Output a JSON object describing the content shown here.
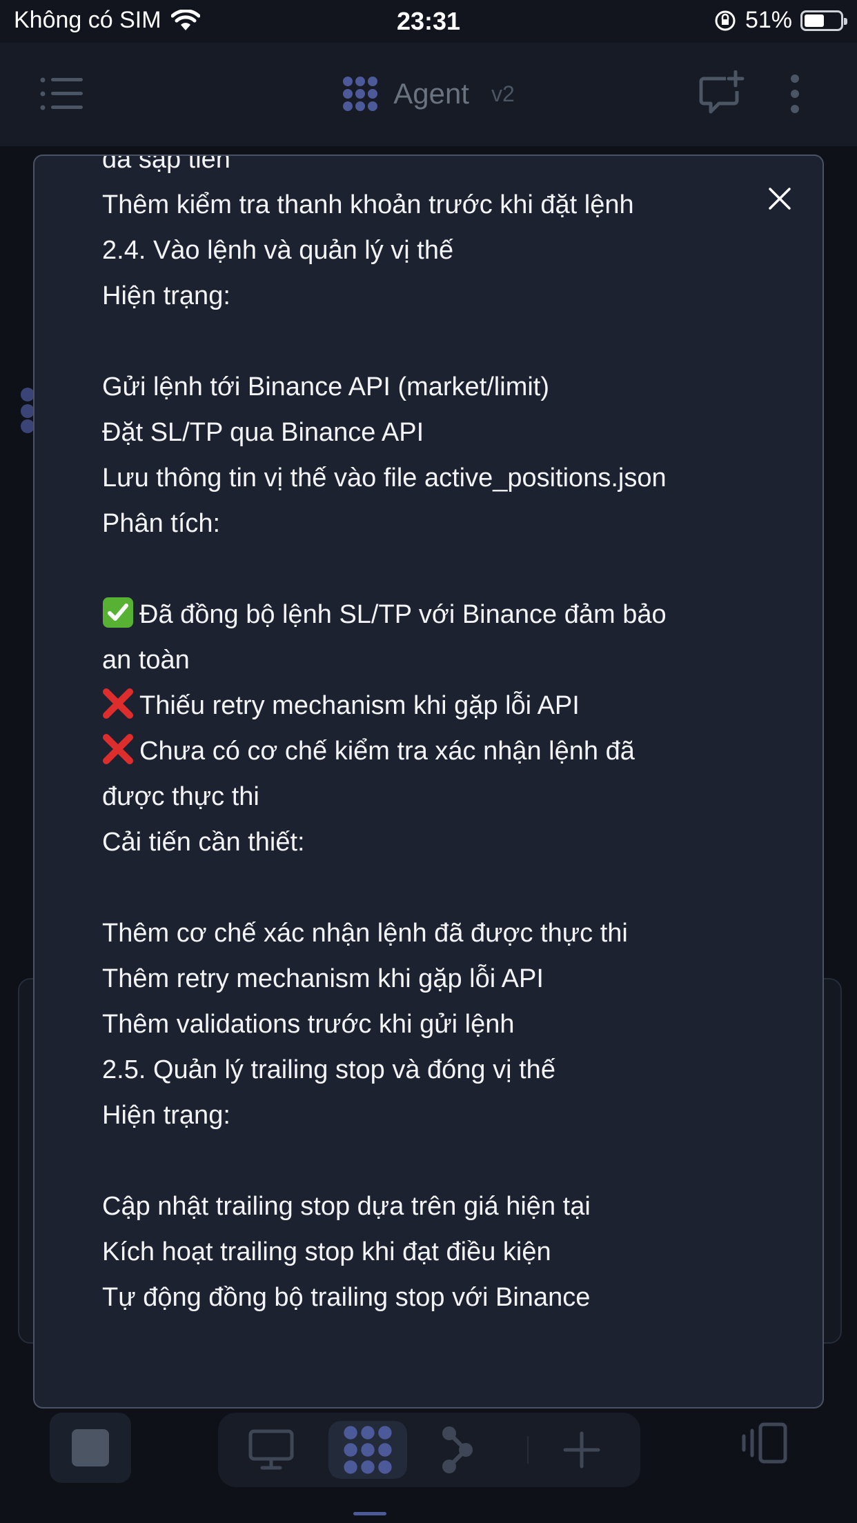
{
  "status_bar": {
    "carrier": "Không có SIM",
    "time": "23:31",
    "battery": "51%",
    "battery_level": 0.51,
    "icons": [
      "wifi-icon",
      "orientation-lock-icon",
      "battery-icon"
    ]
  },
  "header": {
    "title": "Agent",
    "version": "v2",
    "icons": [
      "menu-icon",
      "agent-logo-icon",
      "new-chat-icon",
      "more-vertical-icon"
    ]
  },
  "dialog": {
    "close_icon": "close-icon",
    "lines": [
      "đã sập tiền",
      "Thêm kiểm tra thanh khoản trước khi đặt lệnh",
      "2.4. Vào lệnh và quản lý vị thế",
      "Hiện trạng:",
      "",
      "Gửi lệnh tới Binance API (market/limit)",
      "Đặt SL/TP qua Binance API",
      "Lưu thông tin vị thế vào file active_positions.json",
      "Phân tích:",
      "",
      "Đã đồng bộ lệnh SL/TP với Binance đảm bảo",
      "an toàn",
      "Thiếu retry mechanism khi gặp lỗi API",
      "Chưa có cơ chế kiểm tra xác nhận lệnh đã",
      "được thực thi",
      "Cải tiến cần thiết:",
      "",
      "Thêm cơ chế xác nhận lệnh đã được thực thi",
      "Thêm retry mechanism khi gặp lỗi API",
      "Thêm validations trước khi gửi lệnh",
      "2.5. Quản lý trailing stop và đóng vị thế",
      "Hiện trạng:",
      "",
      "Cập nhật trailing stop dựa trên giá hiện tại",
      "Kích hoạt trailing stop khi đạt điều kiện",
      "Tự động đồng bộ trailing stop với Binance"
    ],
    "line_icons": {
      "10": "check-mark-emoji-icon",
      "12": "cross-mark-emoji-icon",
      "13": "cross-mark-emoji-icon"
    }
  },
  "bottom_bar": {
    "icons": [
      "stop-icon",
      "monitor-icon",
      "agent-logo-icon",
      "workflow-icon",
      "plus-icon",
      "split-view-icon"
    ]
  },
  "colors": {
    "background": "#0e1117",
    "dialog_bg": "#1d2230",
    "accent": "#4c5a99",
    "check_green": "#57b233",
    "cross_red": "#dd2d2d"
  }
}
